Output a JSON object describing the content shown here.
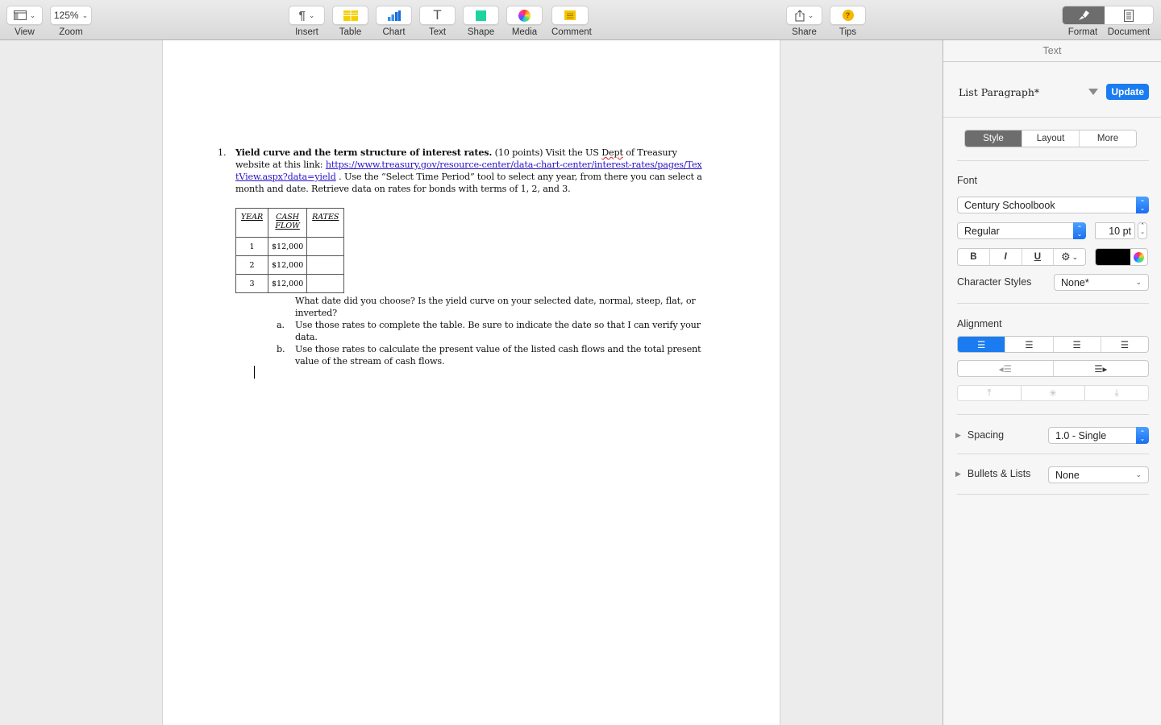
{
  "toolbar": {
    "view": {
      "label": "View",
      "icon": "sidebar-layout-icon"
    },
    "zoom": {
      "label": "Zoom",
      "value": "125%"
    },
    "insert": {
      "label": "Insert",
      "icon": "pilcrow-icon",
      "glyph": "¶"
    },
    "table": {
      "label": "Table",
      "icon": "table-icon"
    },
    "chart": {
      "label": "Chart",
      "icon": "bar-chart-icon"
    },
    "text": {
      "label": "Text",
      "icon": "text-t-icon",
      "glyph": "T"
    },
    "shape": {
      "label": "Shape",
      "icon": "square-shape-icon"
    },
    "media": {
      "label": "Media",
      "icon": "photos-flower-icon"
    },
    "comment": {
      "label": "Comment",
      "icon": "sticky-note-icon"
    },
    "share": {
      "label": "Share",
      "icon": "share-icon"
    },
    "tips": {
      "label": "Tips",
      "icon": "question-icon",
      "glyph": "?"
    },
    "format": {
      "label": "Format",
      "icon": "paintbrush-icon",
      "active": true
    },
    "document": {
      "label": "Document",
      "icon": "document-icon"
    }
  },
  "document": {
    "para1": {
      "number": "1.",
      "bold": "Yield curve and the term structure of interest rates.",
      "text1": " (10 points) Visit the US ",
      "misspelled": "Dept",
      "text2": " of Treasury website at this link: ",
      "link": "https://www.treasury.gov/resource-center/data-chart-center/interest-rates/pages/TextView.aspx?data=yield",
      "text3": " . Use the “Select Time Period” tool to select any year, from there you can select a month and date. Retrieve data on rates for bonds with terms of 1, 2, and 3."
    },
    "table": {
      "headers": [
        "YEAR",
        "CASH FLOW",
        "RATES"
      ],
      "rows": [
        [
          "1",
          "$12,000",
          ""
        ],
        [
          "2",
          "$12,000",
          ""
        ],
        [
          "3",
          "$12,000",
          ""
        ]
      ]
    },
    "question": "What date did you choose? Is the yield curve on your selected date, normal, steep, flat, or inverted?",
    "items": [
      {
        "label": "a.",
        "text": "Use those rates to complete the table. Be sure to indicate the date so that I can verify your data."
      },
      {
        "label": "b.",
        "text": "Use those rates to calculate the present value of the listed cash flows and the total present value of the stream of cash flows."
      }
    ]
  },
  "sidebar": {
    "header": "Text",
    "paragraph_style": "List Paragraph*",
    "update_label": "Update",
    "tabs": [
      "Style",
      "Layout",
      "More"
    ],
    "active_tab": "Style",
    "font_label": "Font",
    "font_family": "Century Schoolbook",
    "font_typeface": "Regular",
    "font_size": "10 pt",
    "bold": "B",
    "italic": "I",
    "underline": "U",
    "text_color": "#000000",
    "character_styles_label": "Character Styles",
    "character_styles_value": "None*",
    "alignment_label": "Alignment",
    "alignment_active": "left",
    "spacing_label": "Spacing",
    "spacing_value": "1.0 - Single",
    "bullets_label": "Bullets & Lists",
    "bullets_value": "None"
  },
  "colors": {
    "accent": "#1a7cf0",
    "link": "#2b14c9"
  }
}
